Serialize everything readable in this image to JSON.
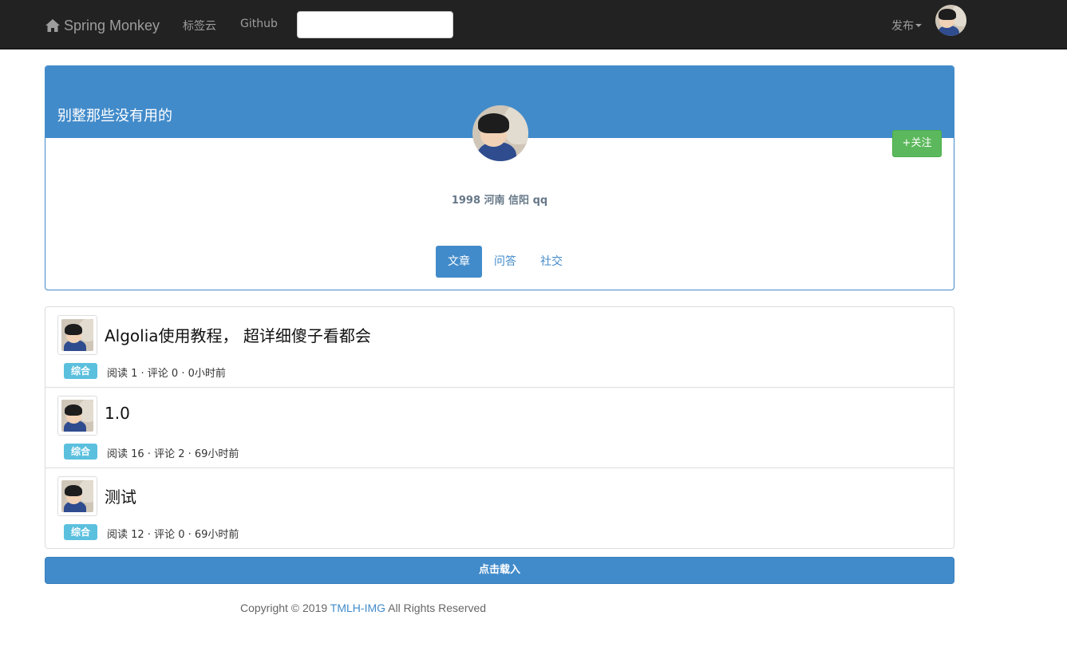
{
  "navbar": {
    "brand": "Spring Monkey",
    "brand_icon": "home-icon",
    "links": [
      "标签云",
      "Github"
    ],
    "search_value": "",
    "publish_label": "发布",
    "bg_color": "#222222"
  },
  "profile": {
    "header_title": "别整那些没有用的",
    "follow_label": "+关注",
    "bio": "1998 河南 信阳 qq",
    "tabs": [
      "文章",
      "问答",
      "社交"
    ],
    "active_tab": "文章",
    "accent_color": "#428bca"
  },
  "articles": [
    {
      "title": "Algolia使用教程， 超详细傻子看都会",
      "tag": "综合",
      "meta": "阅读 1 · 评论 0   · 0小时前"
    },
    {
      "title": "1.0",
      "tag": "综合",
      "meta": "阅读 16 · 评论 2   · 69小时前"
    },
    {
      "title": "测试",
      "tag": "综合",
      "meta": "阅读 12 · 评论 0   · 69小时前"
    }
  ],
  "load_more_label": "点击载入",
  "footer": {
    "prefix": "Copyright © 2019 ",
    "link": "TMLH-IMG",
    "suffix": " All Rights Reserved"
  }
}
